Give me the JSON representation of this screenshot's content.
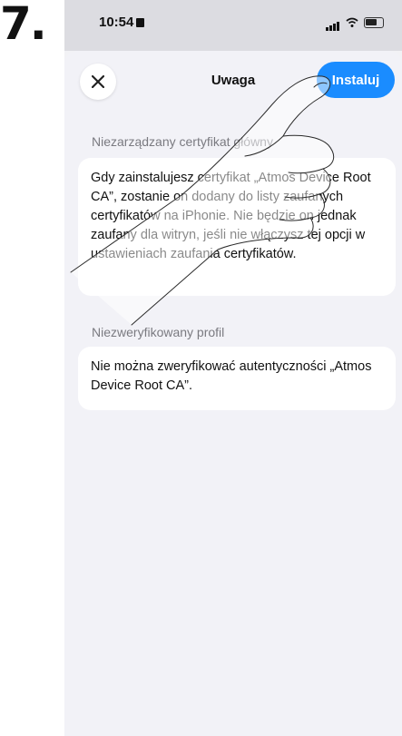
{
  "step": {
    "number": "7."
  },
  "status_bar": {
    "time": "10:54"
  },
  "sheet": {
    "title": "Uwaga",
    "close_label": "close",
    "install_label": "Instaluj"
  },
  "sections": [
    {
      "header": "Niezarządzany certyfikat główny",
      "body": "Gdy zainstalujesz certyfikat „Atmos Device Root CA”, zostanie on dodany do listy zaufanych certyfikatów na iPhonie. Nie będzie on jednak zaufany dla witryn, jeśli nie włączysz tej opcji w ustawieniach zaufania certyfikatów."
    },
    {
      "header": "Niezweryfikowany profil",
      "body": "Nie można zweryfikować autentyczności „Atmos Device Root CA”."
    }
  ],
  "colors": {
    "accent": "#1a8cff",
    "background": "#f2f2f7",
    "card": "#ffffff"
  },
  "icons": {
    "close": "close-icon",
    "signal": "signal-icon",
    "wifi": "wifi-icon",
    "battery": "battery-icon",
    "hand": "pointing-hand-icon"
  }
}
